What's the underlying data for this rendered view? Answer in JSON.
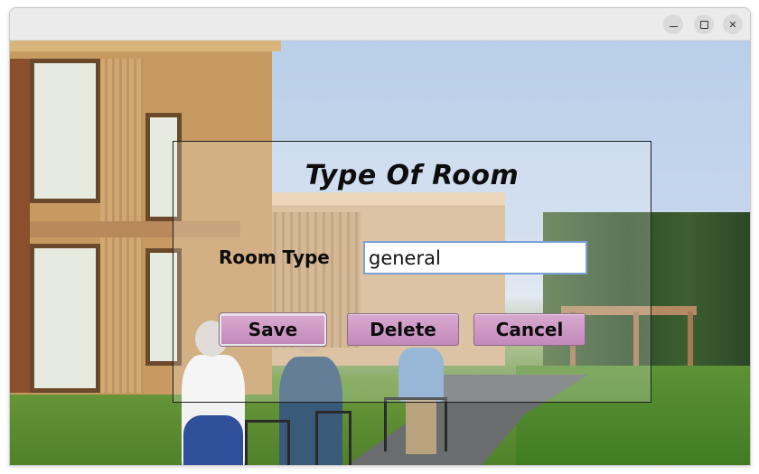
{
  "window": {
    "controls": {
      "minimize_icon": "minimize-icon",
      "maximize_icon": "maximize-icon",
      "close_icon": "close-icon",
      "close_glyph": "✕"
    }
  },
  "dialog": {
    "title": "Type Of Room",
    "room_type_label": "Room Type",
    "room_type_value": "general",
    "buttons": {
      "save": "Save",
      "delete": "Delete",
      "cancel": "Cancel"
    }
  },
  "colors": {
    "button_fill": "#c98fc0",
    "input_border": "#7aa2d4",
    "panel_border": "#1e1e1e"
  }
}
